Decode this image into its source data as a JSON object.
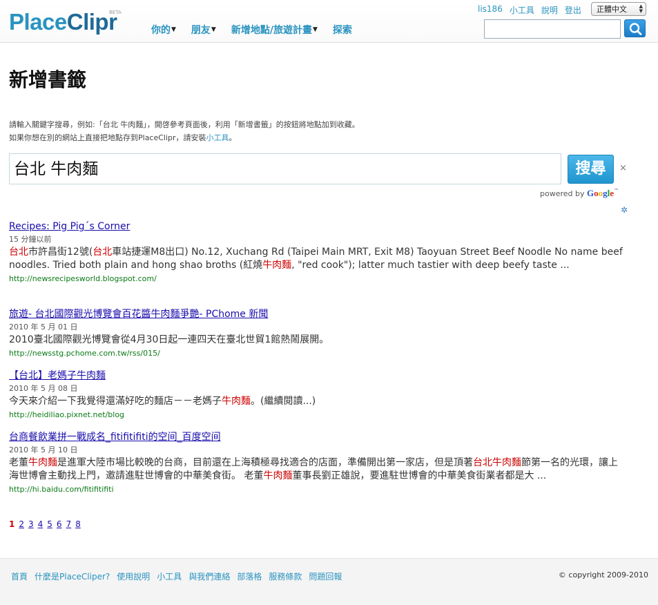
{
  "header": {
    "logo_place": "Place",
    "logo_clipr": "Clipr",
    "beta": "BETA",
    "nav": [
      {
        "label": "你的",
        "caret": "▼"
      },
      {
        "label": "朋友",
        "caret": "▼"
      },
      {
        "label": "新增地點/旅遊計畫",
        "caret": "▼"
      },
      {
        "label": "探索",
        "caret": ""
      }
    ],
    "top_links": [
      "lis186",
      "小工具",
      "說明",
      "登出"
    ],
    "language": "正體中文",
    "search_value": ""
  },
  "main": {
    "title": "新增書籤",
    "intro_line1": "請輸入關鍵字搜尋，例如:「台北 牛肉麵」，開啓參考頁面後，利用「新增書籤」的按鈕將地點加到收藏。",
    "intro_line2_prefix": "如果你想在別的網站上直接把地點存到PlaceClipr，請安裝",
    "intro_line2_link": "小工具",
    "intro_line2_suffix": "。",
    "query": "台北 牛肉麵",
    "search_button": "搜尋",
    "clear": "×",
    "powered_by": "powered by",
    "google": [
      "G",
      "o",
      "o",
      "g",
      "l",
      "e"
    ],
    "tm": "™",
    "settings": "✲"
  },
  "results": [
    {
      "title": "Recipes: Pig Pig´s Corner",
      "date": "15 分鐘以前",
      "snippet": [
        {
          "t": "台北",
          "hl": true
        },
        {
          "t": "市許昌街12號(",
          "hl": false
        },
        {
          "t": "台北",
          "hl": true
        },
        {
          "t": "車站捷運M8出口) No.12, Xuchang Rd (Taipei Main MRT, Exit M8) Taoyuan Street Beef Noodle No name beef noodles. Tried both plain and hong shao broths (紅燒",
          "hl": false
        },
        {
          "t": "牛肉麵",
          "hl": true
        },
        {
          "t": ", \"red cook\"); latter much tastier with deep beefy taste ...",
          "hl": false
        }
      ],
      "url": "http://newsrecipesworld.blogspot.com/"
    },
    {
      "title": "旅遊- 台北國際觀光博覽會百花醬牛肉麵爭艷- PChome 新聞",
      "date": "2010 年 5 月 01 日",
      "snippet": [
        {
          "t": "2010臺北國際觀光博覽會從4月30日起一連四天在臺北世貿1館熱鬧展開。",
          "hl": false
        }
      ],
      "url": "http://newsstg.pchome.com.tw/rss/015/"
    },
    {
      "title": "【台北】老媽子牛肉麵",
      "date": "2010 年 5 月 08 日",
      "snippet": [
        {
          "t": "今天來介紹一下我覺得還滿好吃的麵店－－老媽子",
          "hl": false
        },
        {
          "t": "牛肉麵",
          "hl": true
        },
        {
          "t": "。(繼續閱讀...)",
          "hl": false
        }
      ],
      "url": "http://heidiliao.pixnet.net/blog"
    },
    {
      "title": "台商餐飲業拼一戰成名_fitifitifiti的空间_百度空间",
      "date": "2010 年 5 月 10 日",
      "snippet": [
        {
          "t": "老董",
          "hl": false
        },
        {
          "t": "牛肉麵",
          "hl": true
        },
        {
          "t": "是進軍大陸市場比較晚的台商，目前還在上海積極尋找適合的店面，準備開出第一家店，但是頂著",
          "hl": false
        },
        {
          "t": "台北牛肉麵",
          "hl": true
        },
        {
          "t": "節第一名的光環，讓上海世博會主動找上門，邀請進駐世博會的中華美食街。 老董",
          "hl": false
        },
        {
          "t": "牛肉麵",
          "hl": true
        },
        {
          "t": "董事長劉正雄說，要進駐世博會的中華美食街業者都是大 ...",
          "hl": false
        }
      ],
      "url": "http://hi.baidu.com/fitifitifiti"
    }
  ],
  "pager": {
    "current": "1",
    "pages": [
      "1",
      "2",
      "3",
      "4",
      "5",
      "6",
      "7",
      "8"
    ]
  },
  "footer": {
    "links": [
      "首頁",
      "什麼是PlaceCliper?",
      "使用說明",
      "小工具",
      "與我們連絡",
      "部落格",
      "服務條款",
      "問題回報"
    ],
    "copyright": "© copyright 2009-2010"
  }
}
